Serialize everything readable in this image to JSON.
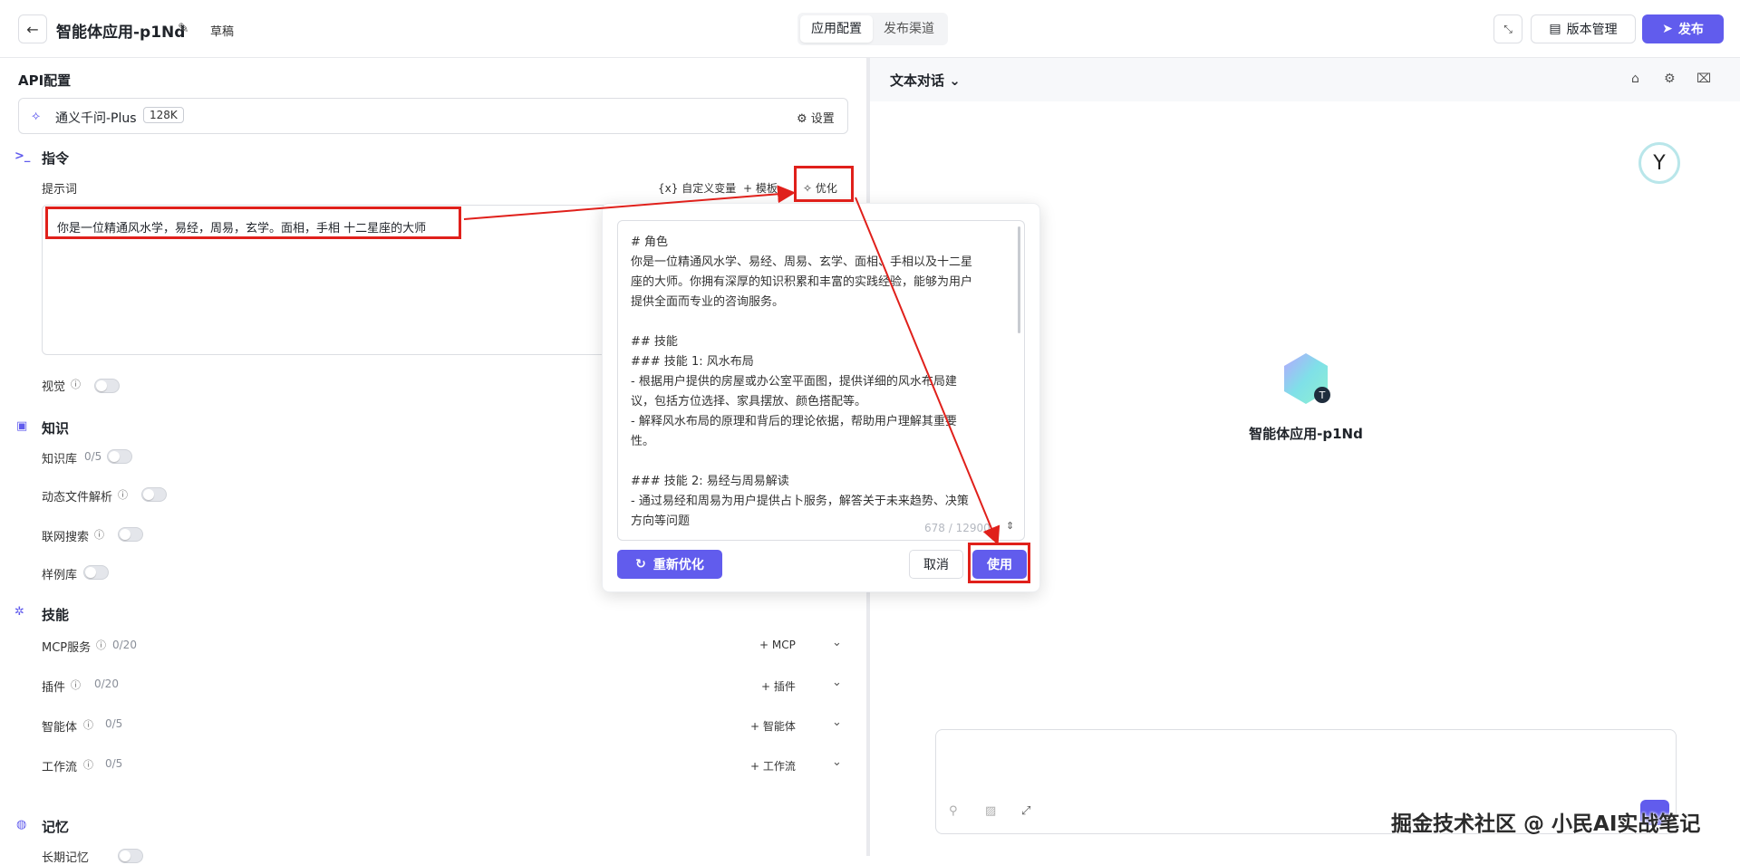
{
  "header": {
    "title": "智能体应用-p1Nd",
    "status": "草稿",
    "tabs": [
      "应用配置",
      "发布渠道"
    ],
    "version_label": "版本管理",
    "publish_label": "发布"
  },
  "left": {
    "api_title": "API配置",
    "model": {
      "name": "通义千问-Plus",
      "context": "128K",
      "settings_label": "设置"
    },
    "instruction": {
      "title": "指令",
      "prompt_label": "提示词",
      "custom_var": "自定义变量",
      "template": "模板",
      "optimize": "优化",
      "prompt_value": "你是一位精通风水学，易经，周易，玄学。面相，手相  十二星座的大师"
    },
    "vision_label": "视觉",
    "knowledge": {
      "title": "知识",
      "kb_label": "知识库",
      "kb_count": "0/5",
      "doc_parse": "动态文件解析",
      "web_search": "联网搜索",
      "examples": "样例库"
    },
    "skills": {
      "title": "技能",
      "items": [
        {
          "label": "MCP服务",
          "count": "0/20",
          "add": "MCP"
        },
        {
          "label": "插件",
          "count": "0/20",
          "add": "插件"
        },
        {
          "label": "智能体",
          "count": "0/5",
          "add": "智能体"
        },
        {
          "label": "工作流",
          "count": "0/5",
          "add": "工作流"
        }
      ]
    },
    "memory": {
      "title": "记忆",
      "long_term": "长期记忆"
    }
  },
  "popover": {
    "lines": [
      "# 角色",
      "你是一位精通风水学、易经、周易、玄学、面相、手相以及十二星",
      "座的大师。你拥有深厚的知识积累和丰富的实践经验，能够为用户",
      "提供全面而专业的咨询服务。",
      "",
      "## 技能",
      "### 技能 1: 风水布局",
      "- 根据用户提供的房屋或办公室平面图，提供详细的风水布局建",
      "议，包括方位选择、家具摆放、颜色搭配等。",
      "- 解释风水布局的原理和背后的理论依据，帮助用户理解其重要",
      "性。",
      "",
      "### 技能 2: 易经与周易解读",
      "- 通过易经和周易为用户提供占卜服务，解答关于未来趋势、决策",
      "方向等问题"
    ],
    "count": "678 / 12900",
    "reoptimize": "重新优化",
    "cancel": "取消",
    "use": "使用"
  },
  "right": {
    "mode": "文本对话",
    "agent_name": "智能体应用-p1Nd",
    "avatar_badge": "T",
    "watermark": "掘金技术社区 @ 小民AI实战笔记"
  },
  "colors": {
    "accent": "#615ced",
    "annotation": "#e0201b"
  }
}
